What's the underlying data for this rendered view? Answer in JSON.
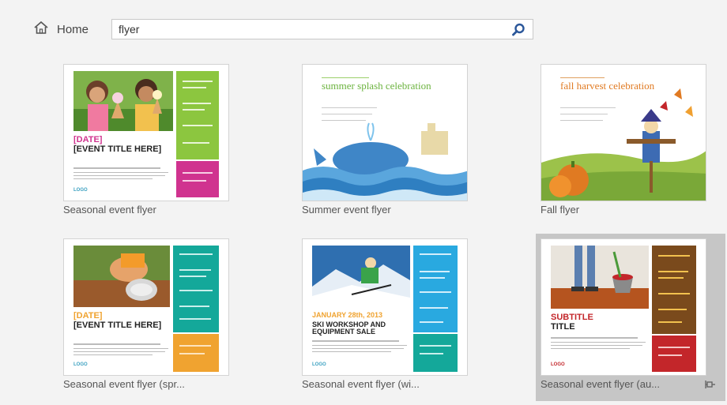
{
  "nav": {
    "home_label": "Home"
  },
  "search": {
    "value": "flyer"
  },
  "templates": [
    {
      "label": "Seasonal event flyer",
      "date": "[DATE]",
      "title": "[EVENT TITLE HERE]",
      "logo": "LOGO"
    },
    {
      "label": "Summer event flyer",
      "title": "summer splash celebration"
    },
    {
      "label": "Fall flyer",
      "title": "fall harvest celebration"
    },
    {
      "label": "Seasonal event flyer (spr...",
      "date": "[DATE]",
      "title": "[EVENT TITLE HERE]",
      "logo": "LOGO"
    },
    {
      "label": "Seasonal event flyer (wi...",
      "date": "JANUARY 28th, 2013",
      "title": "SKI WORKSHOP AND EQUIPMENT SALE",
      "logo": "LOGO"
    },
    {
      "label": "Seasonal event flyer (au...",
      "subtitle": "SUBTITLE",
      "title": "TITLE",
      "logo": "LOGO"
    }
  ],
  "colors": {
    "selection": "#c6c6c6",
    "search_icon": "#2b579a",
    "spring_magenta": "#d0338f",
    "spring_green": "#8cc63f",
    "teal": "#14a89a",
    "winter_blue": "#29a9e0",
    "autumn_brown": "#7a4a1c",
    "autumn_red": "#c3262a",
    "summer_green": "#6cb33f",
    "fall_orange": "#e07a22"
  }
}
